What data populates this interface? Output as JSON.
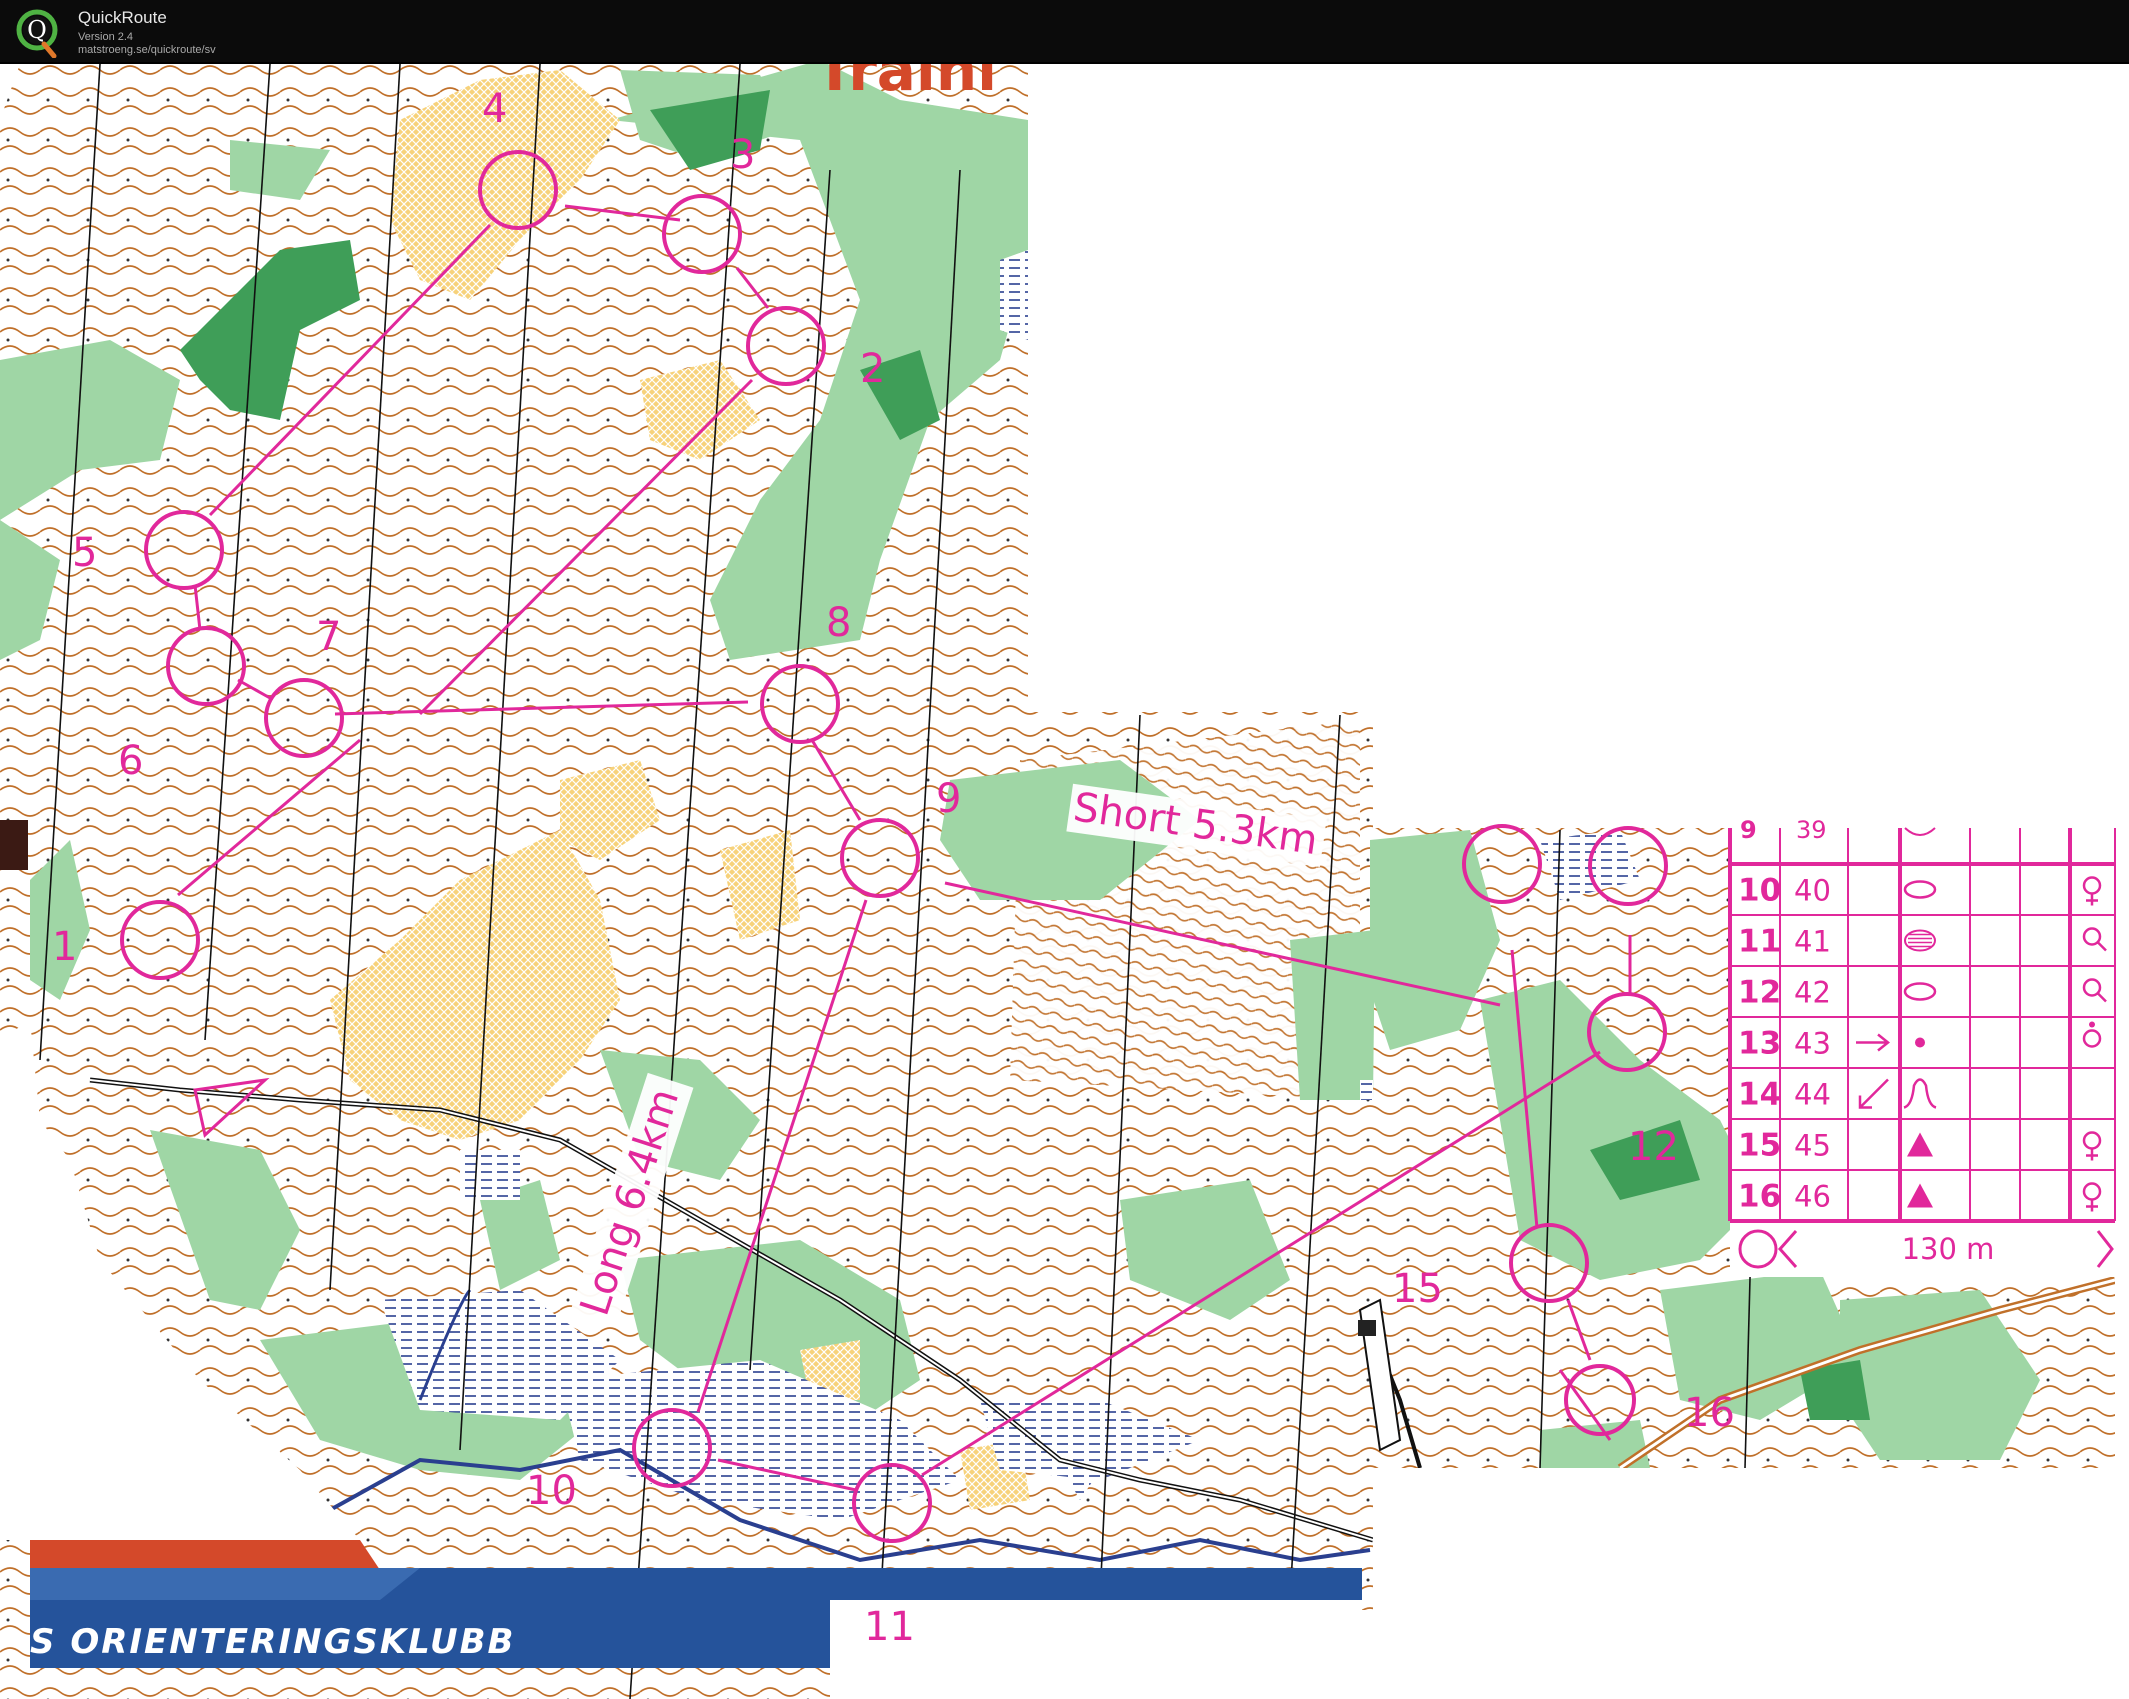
{
  "app": {
    "name": "QuickRoute",
    "version": "Version 2.4",
    "url": "matstroeng.se/quickroute/sv",
    "logo_letter": "Q",
    "logo_icon": "quickroute-q-logo"
  },
  "map": {
    "title_fragment": "Traini",
    "club_banner": "S ORIENTERINGSKLUBB",
    "course_color": "#e1289b",
    "labels": {
      "short_course": "Short 5.3km",
      "long_course": "Long 6.4km"
    },
    "controls": [
      {
        "number": "1"
      },
      {
        "number": "2"
      },
      {
        "number": "3"
      },
      {
        "number": "4"
      },
      {
        "number": "5"
      },
      {
        "number": "6"
      },
      {
        "number": "7"
      },
      {
        "number": "8"
      },
      {
        "number": "9"
      },
      {
        "number": "10"
      },
      {
        "number": "11"
      },
      {
        "number": "12"
      },
      {
        "number": "15"
      },
      {
        "number": "16"
      }
    ],
    "legend": {
      "partial_row": {
        "number": "9",
        "code": "39"
      },
      "rows": [
        {
          "number": "10",
          "code": "40",
          "direction": "",
          "feature": "oval",
          "location": "",
          "appearance": "",
          "other": "",
          "clue": "female-sign"
        },
        {
          "number": "11",
          "code": "41",
          "direction": "",
          "feature": "hatched-oval",
          "location": "",
          "appearance": "",
          "other": "",
          "clue": "female-sign-right"
        },
        {
          "number": "12",
          "code": "42",
          "direction": "",
          "feature": "oval",
          "location": "",
          "appearance": "",
          "other": "",
          "clue": "female-sign-right"
        },
        {
          "number": "13",
          "code": "43",
          "direction": "arrow-right",
          "feature": "dot",
          "location": "",
          "appearance": "",
          "other": "",
          "clue": "female-sign-dot"
        },
        {
          "number": "14",
          "code": "44",
          "direction": "arrow-down-left",
          "feature": "bell-curve",
          "location": "",
          "appearance": "",
          "other": "",
          "clue": ""
        },
        {
          "number": "15",
          "code": "45",
          "direction": "",
          "feature": "triangle",
          "location": "",
          "appearance": "",
          "other": "",
          "clue": "female-sign"
        },
        {
          "number": "16",
          "code": "46",
          "direction": "",
          "feature": "triangle",
          "location": "",
          "appearance": "",
          "other": "",
          "clue": "female-sign"
        }
      ],
      "finish_distance": "130 m"
    },
    "colors": {
      "forest_green": "#9fd6a5",
      "dark_green": "#3f9e58",
      "open_yellow": "#f7d27a",
      "contour_brown": "#c0702a",
      "water_blue": "#2a3f8f",
      "banner_blue": "#25539b",
      "banner_red": "#d4492a"
    }
  }
}
